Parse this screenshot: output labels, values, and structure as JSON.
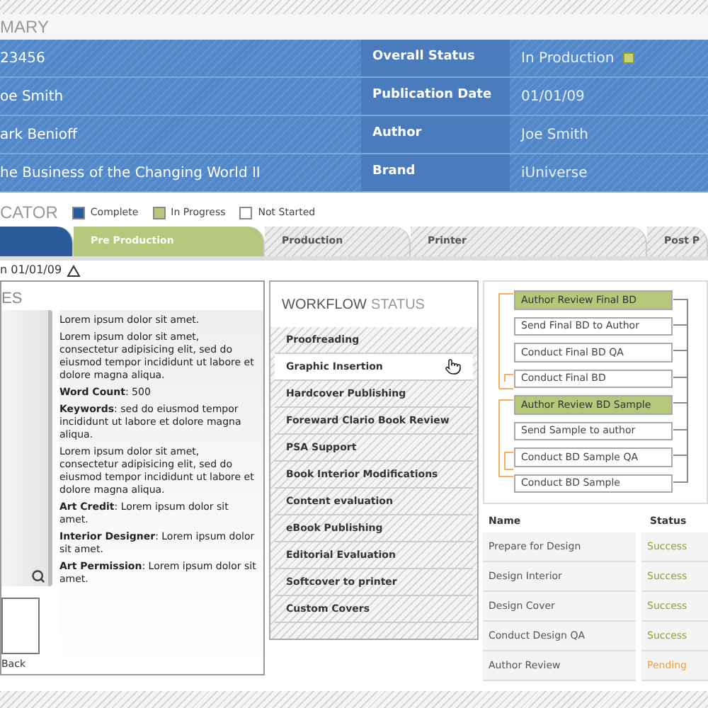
{
  "summary": {
    "title": "MARY",
    "rows": [
      {
        "column_1": "23456",
        "label": "Overall Status",
        "value": "In Production",
        "color": "#c8d46a"
      },
      {
        "column_1": "oe Smith",
        "label": "Publication Date",
        "value": "01/01/09"
      },
      {
        "column_1": "ark Benioff",
        "label": "Author",
        "value": "Joe Smith"
      },
      {
        "column_1": "he Business of the Changing World II",
        "label": "Brand",
        "value": "iUniverse"
      }
    ]
  },
  "legend": {
    "title": "CATOR",
    "items": [
      {
        "label": "Complete",
        "color": "#2a5c9c"
      },
      {
        "label": "In Progress",
        "color": "#b5c77a"
      },
      {
        "label": "Not Started",
        "color": "#ffffff"
      }
    ]
  },
  "phases": [
    {
      "kind": "complete"
    },
    {
      "label": "Pre Production",
      "kind": "progress"
    },
    {
      "label": "Production",
      "kind": "pending"
    },
    {
      "label": "Printer",
      "kind": "pending"
    },
    {
      "label": "Post P",
      "kind": "pending"
    }
  ],
  "date_line": "n 01/01/09",
  "details": {
    "title": "ES",
    "back": "Back",
    "paragraphs": [
      "Lorem ipsum dolor sit amet.",
      "Lorem ipsum dolor sit amet, consectetur adipisicing elit, sed do eiusmod tempor incididunt ut labore et dolore magna aliqua.",
      "**Word Count**: 500",
      "**Keywords**: sed do eiusmod tempor incididunt ut labore et dolore magna aliqua.",
      "Lorem ipsum dolor sit amet, consectetur adipisicing elit, sed do eiusmod tempor incididunt ut labore et dolore magna aliqua.",
      "**Art Credit**: Lorem ipsum dolor sit amet.",
      "**Interior Designer**: Lorem ipsum dolor sit amet.",
      "**Art Permission**: Lorem ipsum dolor sit amet."
    ]
  },
  "workflow": {
    "title_bold": "WORKFLOW",
    "title": "STATUS",
    "items": [
      {
        "label": "Proofreading",
        "selected": false
      },
      {
        "label": "Graphic Insertion",
        "selected": true
      },
      {
        "label": "Hardcover Publishing",
        "selected": false
      },
      {
        "label": "Foreward Clario Book Review",
        "selected": false
      },
      {
        "label": "PSA Support",
        "selected": false
      },
      {
        "label": "Book Interior Modifications",
        "selected": false
      },
      {
        "label": "Content evaluation",
        "selected": false
      },
      {
        "label": "eBook Publishing",
        "selected": false
      },
      {
        "label": "Editorial Evaluation",
        "selected": false
      },
      {
        "label": "Softcover to printer",
        "selected": false
      },
      {
        "label": "Custom Covers",
        "selected": false
      }
    ]
  },
  "flow": [
    {
      "label": "Author Review Final BD",
      "selected": true
    },
    {
      "label": "Send Final BD to Author",
      "selected": false
    },
    {
      "label": "Conduct Final BD QA",
      "selected": false
    },
    {
      "label": "Conduct Final BD",
      "selected": false
    },
    {
      "label": "Author Review BD Sample",
      "selected": true
    },
    {
      "label": "Send Sample to author",
      "selected": false
    },
    {
      "label": "Conduct BD Sample QA",
      "selected": false
    },
    {
      "label": "Conduct BD Sample",
      "selected": false
    }
  ],
  "tasks": {
    "columns": [
      "Name",
      "Status"
    ],
    "rows": [
      {
        "name": "Prepare for Design",
        "status": "Success",
        "kind": "success"
      },
      {
        "name": "Design Interior",
        "status": "Success",
        "kind": "success"
      },
      {
        "name": "Design Cover",
        "status": "Success",
        "kind": "success"
      },
      {
        "name": "Conduct Design QA",
        "status": "Success",
        "kind": "success"
      },
      {
        "name": "Author Review",
        "status": "Pending",
        "kind": "pending"
      }
    ]
  }
}
